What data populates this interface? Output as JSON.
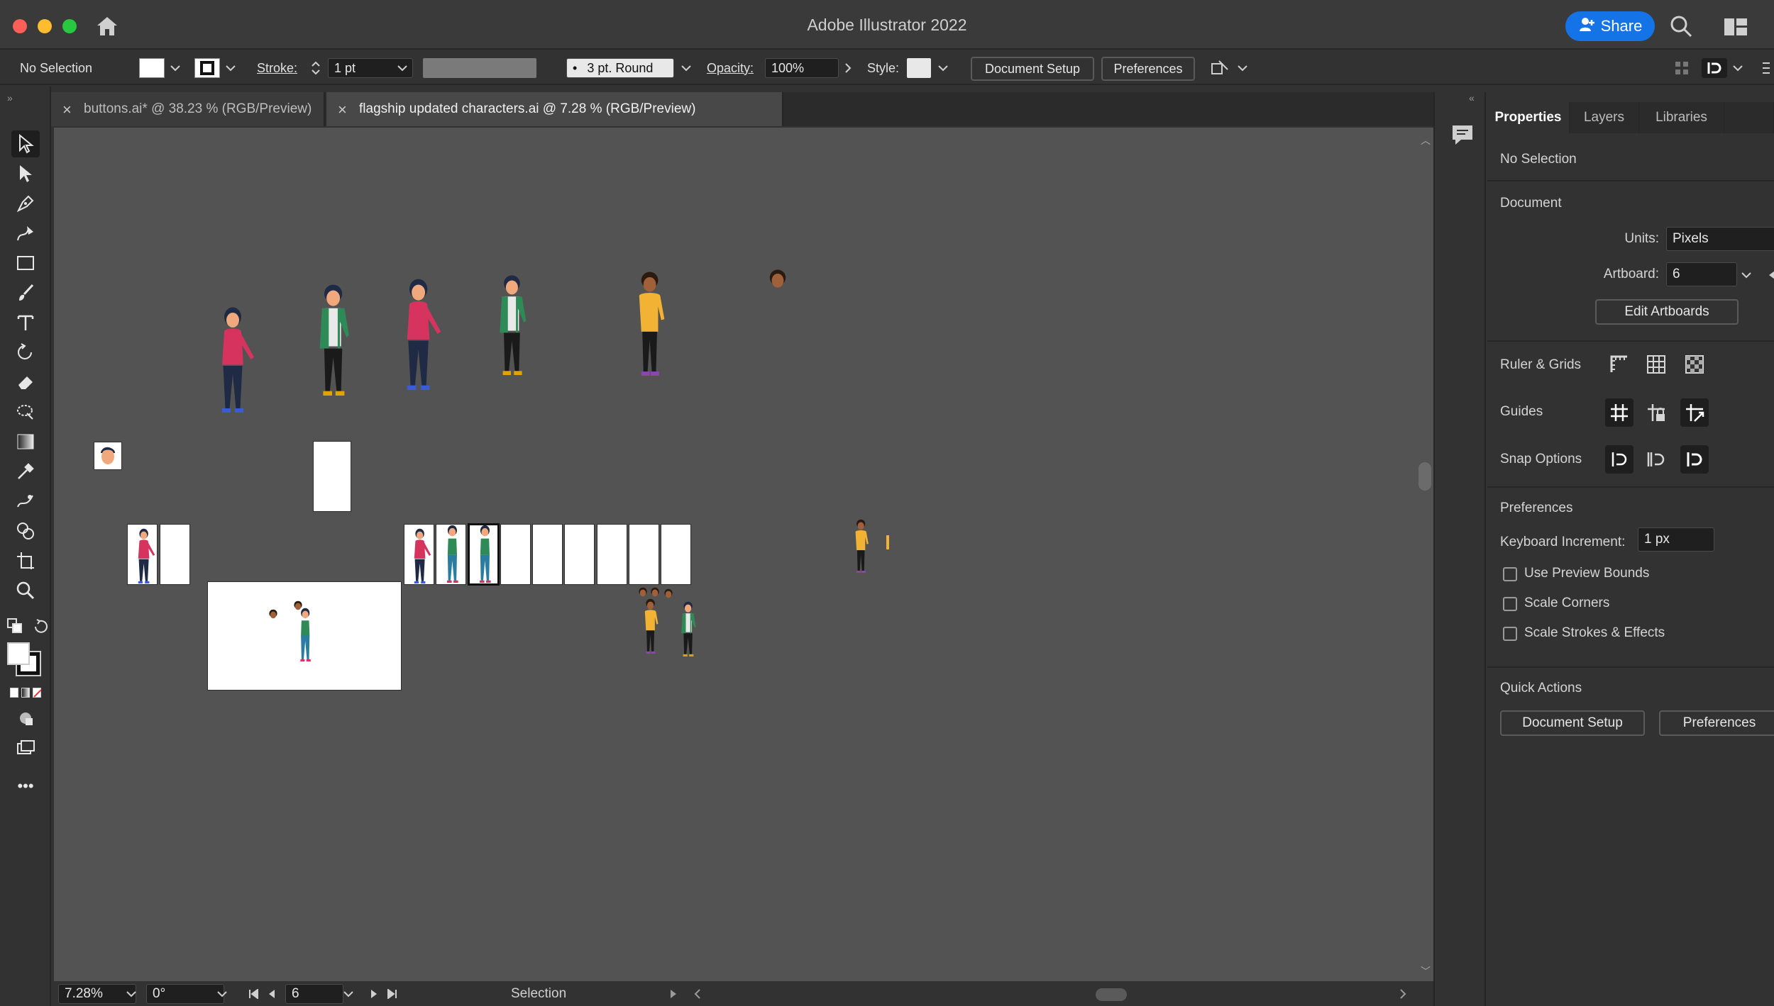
{
  "window": {
    "title": "Adobe Illustrator 2022",
    "share_label": "Share"
  },
  "colors": {
    "accent": "#1473e6",
    "close": "#fe5f57",
    "minimize": "#febc2e",
    "zoom": "#28c840",
    "canvas": "#535353",
    "artboard": "#ffffff",
    "pink": "#d6335f",
    "green": "#2e8b57",
    "yellow": "#f2b233",
    "navy": "#1f2a44"
  },
  "control_bar": {
    "selection": "No Selection",
    "stroke_label": "Stroke:",
    "stroke_value": "1 pt",
    "brush_value": "3 pt. Round",
    "opacity_label": "Opacity:",
    "opacity_value": "100%",
    "style_label": "Style:",
    "document_setup": "Document Setup",
    "preferences": "Preferences"
  },
  "tabs": [
    {
      "label": "buttons.ai* @ 38.23 % (RGB/Preview)",
      "active": false
    },
    {
      "label": "flagship updated characters.ai @ 7.28 % (RGB/Preview)",
      "active": true
    }
  ],
  "status_bar": {
    "zoom": "7.28%",
    "rotation": "0°",
    "artboard": "6",
    "tool": "Selection"
  },
  "panel": {
    "tabs": [
      "Properties",
      "Layers",
      "Libraries"
    ],
    "selection": "No Selection",
    "document_heading": "Document",
    "units_label": "Units:",
    "units_value": "Pixels",
    "artboard_label": "Artboard:",
    "artboard_value": "6",
    "edit_artboards": "Edit Artboards",
    "ruler_grids": "Ruler & Grids",
    "guides": "Guides",
    "snap_options": "Snap Options",
    "preferences_heading": "Preferences",
    "keyboard_increment_label": "Keyboard Increment:",
    "keyboard_increment_value": "1 px",
    "use_preview_bounds": "Use Preview Bounds",
    "scale_corners": "Scale Corners",
    "scale_strokes": "Scale Strokes & Effects",
    "quick_actions": "Quick Actions",
    "qa_document_setup": "Document Setup",
    "qa_preferences": "Preferences"
  }
}
